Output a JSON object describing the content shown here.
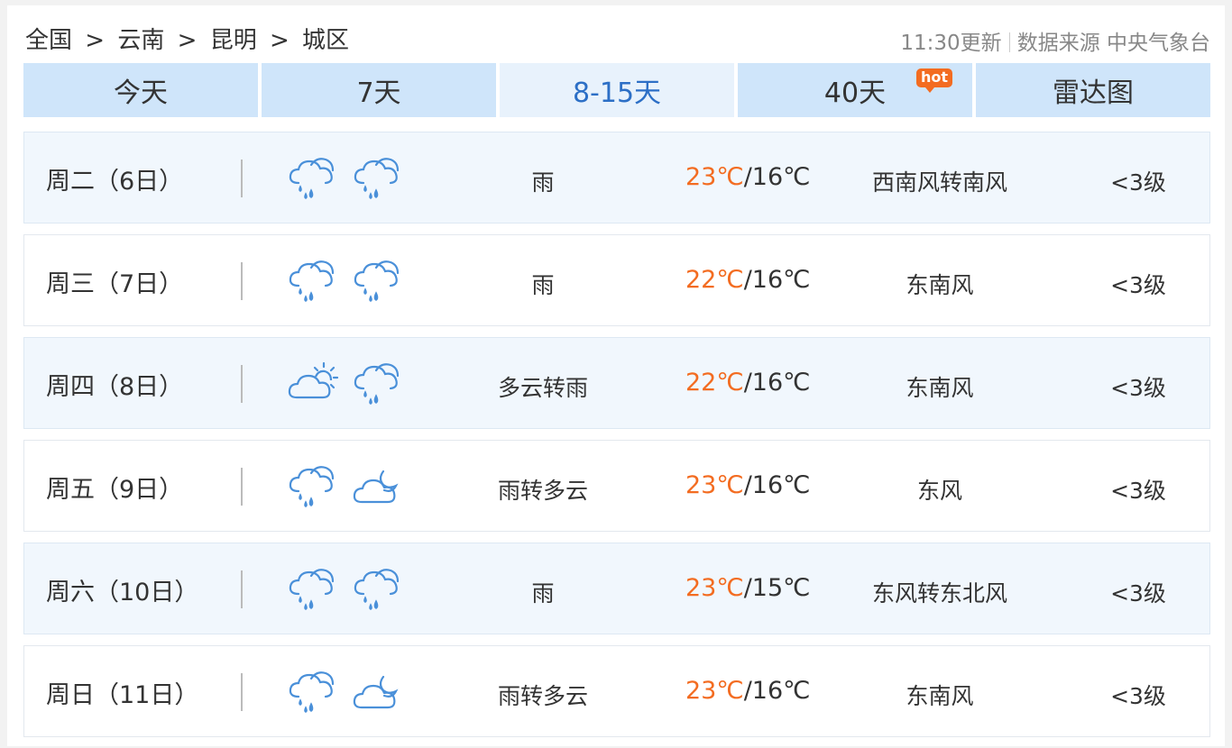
{
  "breadcrumb": [
    "全国",
    "云南",
    "昆明",
    "城区"
  ],
  "breadcrumb_separator": ">",
  "update_time": "11:30更新",
  "source": "数据来源 中央气象台",
  "tabs": [
    {
      "label": "今天",
      "active": false
    },
    {
      "label": "7天",
      "active": false
    },
    {
      "label": "8-15天",
      "active": true
    },
    {
      "label": "40天",
      "active": false,
      "badge": "hot"
    },
    {
      "label": "雷达图",
      "active": false
    }
  ],
  "colors": {
    "accent": "#2c6fc6",
    "hot": "#f36c21",
    "tab_bg": "#cfe5fa",
    "icon": "#4a90d9"
  },
  "forecast": [
    {
      "day": "周二（6日）",
      "icons": [
        "rain-icon",
        "rain-icon"
      ],
      "weather": "雨",
      "high": "23℃",
      "low": "/16℃",
      "wind": "西南风转南风",
      "level": "<3级"
    },
    {
      "day": "周三（7日）",
      "icons": [
        "rain-icon",
        "rain-icon"
      ],
      "weather": "雨",
      "high": "22℃",
      "low": "/16℃",
      "wind": "东南风",
      "level": "<3级"
    },
    {
      "day": "周四（8日）",
      "icons": [
        "partly-cloudy-icon",
        "rain-icon"
      ],
      "weather": "多云转雨",
      "high": "22℃",
      "low": "/16℃",
      "wind": "东南风",
      "level": "<3级"
    },
    {
      "day": "周五（9日）",
      "icons": [
        "rain-icon",
        "cloudy-night-icon"
      ],
      "weather": "雨转多云",
      "high": "23℃",
      "low": "/16℃",
      "wind": "东风",
      "level": "<3级"
    },
    {
      "day": "周六（10日）",
      "icons": [
        "rain-icon",
        "rain-icon"
      ],
      "weather": "雨",
      "high": "23℃",
      "low": "/15℃",
      "wind": "东风转东北风",
      "level": "<3级"
    },
    {
      "day": "周日（11日）",
      "icons": [
        "rain-icon",
        "cloudy-night-icon"
      ],
      "weather": "雨转多云",
      "high": "23℃",
      "low": "/16℃",
      "wind": "东南风",
      "level": "<3级"
    }
  ]
}
